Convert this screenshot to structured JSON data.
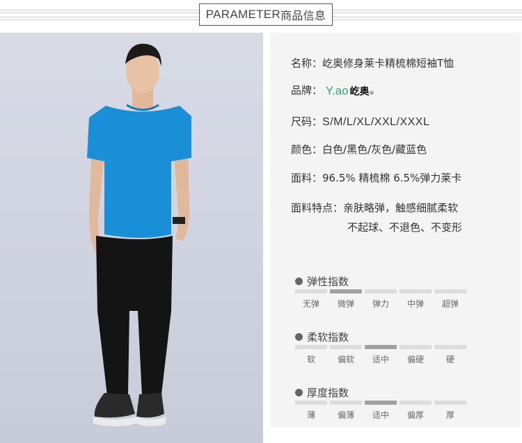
{
  "header": {
    "title_en": "PARAMETER",
    "title_cn": "商品信息"
  },
  "specs": {
    "name_label": "名称：",
    "name_value": "屹奥修身莱卡精梳棉短袖T恤",
    "brand_label": "品牌：",
    "brand_logo_latin": "Y.ao",
    "brand_logo_cn": "屹奥",
    "brand_logo_reg": "®",
    "size_label": "尺码：",
    "size_value": "S/M/L/XL/XXL/XXXL",
    "color_label": "颜色：",
    "color_value": "白色/黑色/灰色/藏蓝色",
    "fabric_label": "面料：",
    "fabric_value": "96.5% 精梳棉  6.5%弹力莱卡",
    "feature_label": "面料特点：",
    "feature_line1": "亲肤略弹，触感细腻柔软",
    "feature_line2": "不起球、不退色、不变形"
  },
  "indexes": [
    {
      "title": "弹性指数",
      "levels": [
        "无弹",
        "微弹",
        "弹力",
        "中弹",
        "超弹"
      ],
      "selected": 1
    },
    {
      "title": "柔软指数",
      "levels": [
        "软",
        "偏软",
        "适中",
        "偏硬",
        "硬"
      ],
      "selected": 2
    },
    {
      "title": "厚度指数",
      "levels": [
        "薄",
        "偏薄",
        "适中",
        "偏厚",
        "厚"
      ],
      "selected": 2
    }
  ],
  "colors": {
    "shirt": "#1a8fd8",
    "pants": "#141414",
    "accent_bar": "#a0a0a0",
    "bar": "#dcdcdc",
    "logo_green": "#2aa86b"
  }
}
